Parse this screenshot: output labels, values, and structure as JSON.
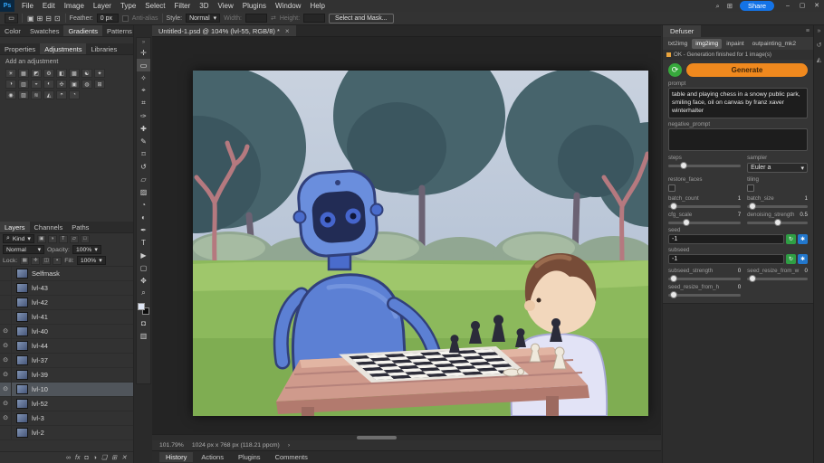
{
  "colors": {
    "share-blue": "#1473e6",
    "generate-orange": "#f0891e",
    "status-orange": "#e8a33d",
    "seed-green": "#2f9e44",
    "seed-blue": "#2277cc",
    "accent-blue": "#31a8ff"
  },
  "glyphs": {
    "dropdown": "▾",
    "close": "×",
    "double_chevron": "»",
    "hamburger": "≡",
    "search": "⌕",
    "workspace": "⊞",
    "eye": "⊙",
    "arrow_right": "›",
    "swap": "⇄",
    "settings_circle": "⟳",
    "refresh": "↻",
    "random": "✱"
  },
  "menubar": {
    "logo": "Ps",
    "items": [
      "File",
      "Edit",
      "Image",
      "Layer",
      "Type",
      "Select",
      "Filter",
      "3D",
      "View",
      "Plugins",
      "Window",
      "Help"
    ],
    "share_label": "Share",
    "window_controls": [
      {
        "name": "minimize-button",
        "glyph": "–"
      },
      {
        "name": "maximize-button",
        "glyph": "▢"
      },
      {
        "name": "close-button",
        "glyph": "✕"
      }
    ]
  },
  "optionsbar": {
    "tool_glyph": "▭",
    "mode_icons": [
      {
        "name": "new-selection-icon",
        "glyph": "▣"
      },
      {
        "name": "add-selection-icon",
        "glyph": "⊞"
      },
      {
        "name": "subtract-selection-icon",
        "glyph": "⊟"
      },
      {
        "name": "intersect-selection-icon",
        "glyph": "⊡"
      }
    ],
    "feather_label": "Feather:",
    "feather_value": "0 px",
    "antialias_label": "Anti-alias",
    "style_label": "Style:",
    "style_value": "Normal",
    "width_label": "Width:",
    "height_label": "Height:",
    "select_mask_label": "Select and Mask..."
  },
  "toolbar": {
    "tools": [
      {
        "name": "move-tool",
        "glyph": "✛"
      },
      {
        "name": "marquee-tool",
        "glyph": "▭",
        "active": true
      },
      {
        "name": "lasso-tool",
        "glyph": "✧"
      },
      {
        "name": "object-selection-tool",
        "glyph": "⌖"
      },
      {
        "name": "crop-tool",
        "glyph": "⌗"
      },
      {
        "name": "eyedropper-tool",
        "glyph": "✑"
      },
      {
        "name": "healing-brush-tool",
        "glyph": "✚"
      },
      {
        "name": "brush-tool",
        "glyph": "✎"
      },
      {
        "name": "clone-stamp-tool",
        "glyph": "⌑"
      },
      {
        "name": "history-brush-tool",
        "glyph": "↺"
      },
      {
        "name": "eraser-tool",
        "glyph": "▱"
      },
      {
        "name": "gradient-tool",
        "glyph": "▨"
      },
      {
        "name": "blur-tool",
        "glyph": "◔"
      },
      {
        "name": "dodge-tool",
        "glyph": "◐"
      },
      {
        "name": "pen-tool",
        "glyph": "✒"
      },
      {
        "name": "type-tool",
        "glyph": "T"
      },
      {
        "name": "path-selection-tool",
        "glyph": "▶"
      },
      {
        "name": "shape-tool",
        "glyph": "▢"
      },
      {
        "name": "hand-tool",
        "glyph": "✥"
      },
      {
        "name": "zoom-tool",
        "glyph": "⌕"
      }
    ],
    "extra_icons": [
      {
        "name": "quick-mask-icon",
        "glyph": "◘"
      },
      {
        "name": "screen-mode-icon",
        "glyph": "▥"
      }
    ]
  },
  "left_panels": {
    "color_tabs": [
      {
        "label": "Color"
      },
      {
        "label": "Swatches"
      },
      {
        "label": "Gradients",
        "active": true
      },
      {
        "label": "Patterns"
      }
    ],
    "prop_tabs": [
      {
        "label": "Properties"
      },
      {
        "label": "Adjustments",
        "active": true
      },
      {
        "label": "Libraries"
      }
    ],
    "add_adjustment_label": "Add an adjustment",
    "adjustment_icons": [
      "☀",
      "▦",
      "◩",
      "⚙",
      "◧",
      "▩",
      "☯",
      "✦",
      "◑",
      "▥",
      "◒",
      "◐",
      "✣",
      "▣",
      "◍",
      "⊞",
      "◉",
      "▨",
      "≋",
      "◭",
      "◓",
      "◔"
    ]
  },
  "layers_panel": {
    "tabs": [
      {
        "label": "Layers",
        "active": true
      },
      {
        "label": "Channels"
      },
      {
        "label": "Paths"
      }
    ],
    "filter_label": "Kind",
    "filter_icons": [
      "▣",
      "◑",
      "T",
      "▱",
      "□"
    ],
    "blend_mode": "Normal",
    "opacity_label": "Opacity:",
    "opacity_value": "100%",
    "lock_label": "Lock:",
    "lock_icons": [
      "▦",
      "✛",
      "◫",
      "▪"
    ],
    "fill_label": "Fill:",
    "fill_value": "100%",
    "rows": [
      {
        "name": "Selfmask",
        "eye": false
      },
      {
        "name": "lvl-43",
        "eye": false
      },
      {
        "name": "lvl-42",
        "eye": false
      },
      {
        "name": "lvl-41",
        "eye": false
      },
      {
        "name": "lvl-40",
        "eye": true
      },
      {
        "name": "lvl-44",
        "eye": true
      },
      {
        "name": "lvl-37",
        "eye": true
      },
      {
        "name": "lvl-39",
        "eye": true
      },
      {
        "name": "lvl-10",
        "eye": true,
        "selected": true
      },
      {
        "name": "lvl-52",
        "eye": true
      },
      {
        "name": "lvl-3",
        "eye": true
      },
      {
        "name": "lvl-2",
        "eye": false
      }
    ],
    "bottom_icons": [
      {
        "name": "link-layers-icon",
        "glyph": "∞"
      },
      {
        "name": "layer-effects-icon",
        "glyph": "fx"
      },
      {
        "name": "layer-mask-icon",
        "glyph": "◘"
      },
      {
        "name": "adjustment-layer-icon",
        "glyph": "◑"
      },
      {
        "name": "layer-group-icon",
        "glyph": "❏"
      },
      {
        "name": "new-layer-icon",
        "glyph": "⊞"
      },
      {
        "name": "delete-layer-icon",
        "glyph": "✕"
      }
    ]
  },
  "document": {
    "tab_title": "Untitled-1.psd @ 104% (lvl-55, RGB/8) *",
    "zoom_value": "101.79%",
    "dimensions": "1024 px x 768 px (118.21 ppcm)"
  },
  "dock_tabs": [
    {
      "label": "History",
      "active": true
    },
    {
      "label": "Actions"
    },
    {
      "label": "Plugins"
    },
    {
      "label": "Comments"
    }
  ],
  "sd": {
    "panel_title": "Defuser",
    "tabs": [
      {
        "label": "txt2img"
      },
      {
        "label": "img2img",
        "active": true
      },
      {
        "label": "inpaint"
      },
      {
        "label": "outpainting_mk2"
      }
    ],
    "status_text": "OK - Generation finished for 1 image(s)",
    "generate_label": "Generate",
    "prompt_label": "prompt",
    "prompt": "table and playing chess in a snowy public park, smiling face, oil on canvas by franz xaver winterhalter",
    "negative_prompt_label": "negative_prompt",
    "negative_prompt": "",
    "controls": {
      "steps": {
        "label": "steps"
      },
      "sampler": {
        "label": "sampler",
        "value": "Euler a"
      },
      "restore_faces": {
        "label": "restore_faces"
      },
      "tiling": {
        "label": "tiling"
      },
      "batch_count": {
        "label": "batch_count",
        "value": "1"
      },
      "batch_size": {
        "label": "batch_size",
        "value": "1"
      },
      "cfg_scale": {
        "label": "cfg_scale",
        "value": "7"
      },
      "denoising_strength": {
        "label": "denoising_strength",
        "value": "0.5"
      },
      "seed": {
        "label": "seed",
        "value": "-1"
      },
      "subseed": {
        "label": "subseed",
        "value": "-1"
      },
      "subseed_strength": {
        "label": "subseed_strength",
        "value": "0"
      },
      "seed_resize_from_w": {
        "label": "seed_resize_from_w",
        "value": "0"
      },
      "seed_resize_from_h": {
        "label": "seed_resize_from_h",
        "value": "0"
      }
    }
  },
  "right_strip": {
    "icons": [
      {
        "name": "collapse-panels-icon",
        "glyph": "»"
      },
      {
        "name": "history-panel-icon",
        "glyph": "↺"
      },
      {
        "name": "comments-panel-icon",
        "glyph": "◭"
      }
    ]
  }
}
